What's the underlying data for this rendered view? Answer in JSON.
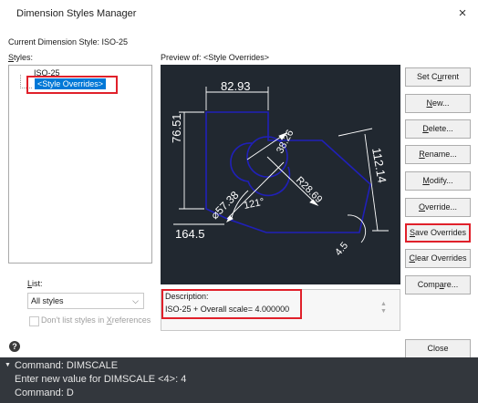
{
  "window": {
    "title": "Dimension Styles Manager",
    "close_glyph": "×"
  },
  "current_style": "Current Dimension Style: ISO-25",
  "styles_label": {
    "prefix": "",
    "u": "S",
    "rest": "tyles:"
  },
  "preview_label": "Preview of: <Style Overrides>",
  "styles_list": {
    "parent": "ISO-25",
    "selected": "<Style Overrides>"
  },
  "preview": {
    "dims": {
      "top": "82.93",
      "left": "76.51",
      "diameter": "⌀57.38",
      "radius_small": "38.26",
      "angle": "121°",
      "radius_large": "R28.69",
      "right": "112.14",
      "bottom_left": "164.5",
      "bottom_right": "4.5"
    },
    "colors": {
      "background": "#212830",
      "geometry": "#2020b8",
      "dimension": "#ffffff"
    }
  },
  "buttons": {
    "set_current": {
      "pre": "Set C",
      "u": "u",
      "post": "rrent"
    },
    "new": {
      "pre": "",
      "u": "N",
      "post": "ew..."
    },
    "delete": {
      "pre": "",
      "u": "D",
      "post": "elete..."
    },
    "rename": {
      "pre": "",
      "u": "R",
      "post": "ename..."
    },
    "modify": {
      "pre": "",
      "u": "M",
      "post": "odify..."
    },
    "override": {
      "pre": "",
      "u": "O",
      "post": "verride..."
    },
    "save_overrides": {
      "pre": "",
      "u": "S",
      "post": "ave Overrides"
    },
    "clear_overrides": {
      "pre": "",
      "u": "C",
      "post": "lear Overrides"
    },
    "compare": {
      "pre": "Comp",
      "u": "a",
      "post": "re..."
    },
    "close": {
      "pre": "Close",
      "u": "",
      "post": ""
    }
  },
  "list": {
    "label_u": "L",
    "label_rest": "ist:",
    "value": "All styles",
    "arrow": "⌵"
  },
  "xref_checkbox": {
    "pre": "Don't list styles in ",
    "u": "X",
    "post": "references",
    "checked": false
  },
  "description": {
    "label": "Description:",
    "text": "ISO-25 + Overall scale= 4.000000"
  },
  "help_icon": "?",
  "command_line": {
    "lines": [
      "Command: DIMSCALE",
      "Enter new value for DIMSCALE <4>: 4",
      "Command: D"
    ]
  },
  "accent_colors": {
    "highlight": "#e0202a",
    "selection": "#0078d7"
  }
}
